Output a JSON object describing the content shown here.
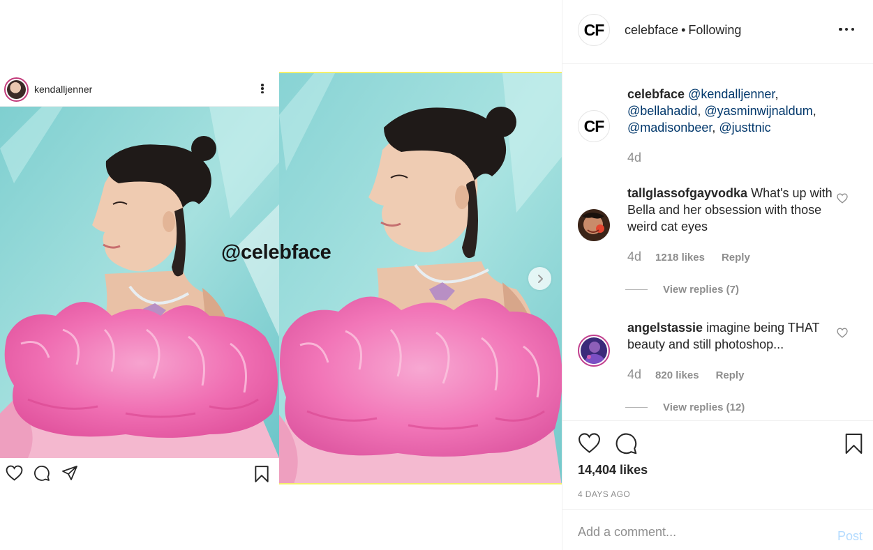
{
  "media": {
    "original_post": {
      "username": "kendalljenner",
      "icons": [
        "avatar",
        "more-icon",
        "heart-icon",
        "comment-icon",
        "share-icon",
        "bookmark-icon"
      ]
    },
    "watermark": "@celebface",
    "next_icon": "chevron-right-icon"
  },
  "header": {
    "avatar_text": "CF",
    "username": "celebface",
    "separator": "•",
    "follow_status": "Following",
    "more_icon": "more-horizontal-icon"
  },
  "caption": {
    "avatar_text": "CF",
    "username": "celebface",
    "mentions": [
      "@kendalljenner",
      "@bellahadid",
      "@yasminwijnaldum",
      "@madisonbeer",
      "@justtnic"
    ],
    "age": "4d"
  },
  "comments": [
    {
      "username": "tallglassofgayvodka",
      "text": "What's up with Bella and her obsession with those weird cat eyes",
      "age": "4d",
      "likes": "1218 likes",
      "reply": "Reply",
      "view_replies": "View replies (7)"
    },
    {
      "username": "angelstassie",
      "text": "imagine being THAT beauty and still photoshop...",
      "age": "4d",
      "likes": "820 likes",
      "reply": "Reply",
      "view_replies": "View replies (12)"
    }
  ],
  "actions": {
    "icons": [
      "heart-icon",
      "comment-icon",
      "bookmark-icon"
    ],
    "likes": "14,404 likes",
    "time_ago": "4 DAYS AGO"
  },
  "add_comment": {
    "placeholder": "Add a comment...",
    "post_label": "Post"
  },
  "colors": {
    "mention": "#00376b",
    "post_disabled": "#b3dbff",
    "muted": "#8e8e8e",
    "background_teal": "#8fd6d6",
    "dress_pink": "#f06fb3"
  }
}
